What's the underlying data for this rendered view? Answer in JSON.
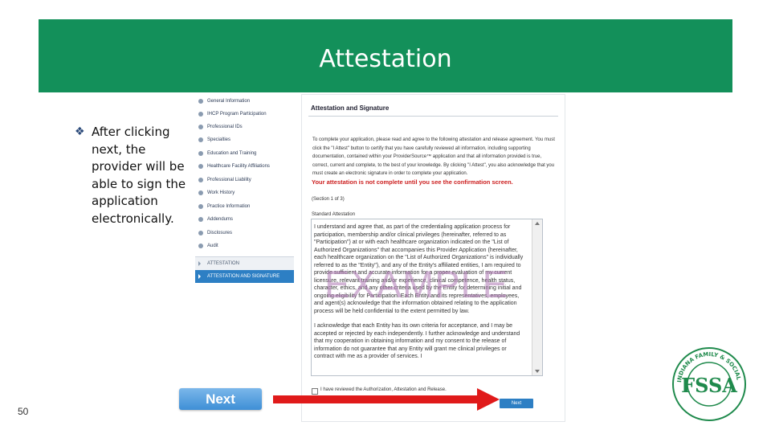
{
  "banner": {
    "title": "Attestation"
  },
  "bullet": {
    "text": "After clicking next, the provider will be able to sign the application electronically."
  },
  "nav": {
    "items": [
      "General Information",
      "IHCP Program Participation",
      "Professional IDs",
      "Specialties",
      "Education and Training",
      "Healthcare Facility Affiliations",
      "Professional Liability",
      "Work History",
      "Practice Information",
      "Addendums",
      "Disclosures",
      "Audit"
    ],
    "section": "ATTESTATION",
    "active": "ATTESTATION AND SIGNATURE"
  },
  "form": {
    "title": "Attestation and Signature",
    "instructions": "To complete your application, please read and agree to the following attestation and release agreement. You must click the \"I Attest\" button to certify that you have carefully reviewed all information, including supporting documentation, contained within your ProviderSource™ application and that all information provided is true, correct, current and complete, to the best of your knowledge. By clicking \"I Attest\", you also acknowledge that you must create an electronic signature in order to complete your application.",
    "warning": "Your attestation is not complete until you see the confirmation screen.",
    "section_label": "(Section 1 of 3)",
    "standard_label": "Standard Attestation",
    "paragraph1": "I understand and agree that, as part of the credentialing application process for participation, membership and/or clinical privileges (hereinafter, referred to as \"Participation\") at or with each healthcare organization indicated on the \"List of Authorized Organizations\" that accompanies this Provider Application (hereinafter, each healthcare organization on the \"List of Authorized Organizations\" is individually referred to as the \"Entity\"), and any of the Entity's affiliated entities, I am required to provide sufficient and accurate information for a proper evaluation of my current licensure, relevant training and/or experience, clinical competence, health status, character, ethics, and any other criteria used by the Entity for determining initial and ongoing eligibility for Participation. Each Entity and its representatives, employees, and agent(s) acknowledge that the information obtained relating to the application process will be held confidential to the extent permitted by law.",
    "paragraph2": "I acknowledge that each Entity has its own criteria for acceptance, and I may be accepted or rejected by each independently. I further acknowledge and understand that my cooperation in obtaining information and my consent to the release of information do not guarantee that any Entity will grant me clinical privileges or contract with me as a provider of services. I",
    "watermark": "EXAMPLE",
    "checkbox_label": "I have reviewed the Authorization, Attestation and Release.",
    "next_label": "Next"
  },
  "big_next_label": "Next",
  "page_number": "50",
  "logo": {
    "text": "INDIANA FAMILY & SOCIAL SERVICES ADMINISTRATION",
    "mark": "FSSA"
  },
  "colors": {
    "banner": "#13905a",
    "arrow": "#e01a1a",
    "nav_active": "#2d7fc4",
    "warning": "#cc1f1f"
  }
}
